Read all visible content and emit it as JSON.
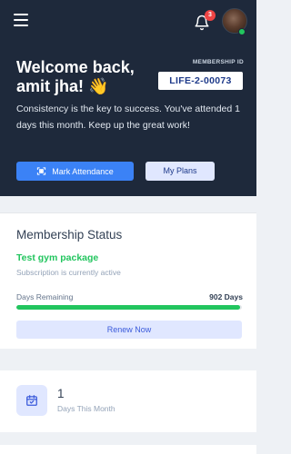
{
  "header": {
    "notification_count": "3",
    "status_color": "#22c55e"
  },
  "hero": {
    "welcome_line1": "Welcome back,",
    "welcome_name": "amit jha!",
    "wave_emoji": "👋",
    "membership_id_label": "MEMBERSHIP ID",
    "membership_id": "LIFE-2-00073",
    "motivation": "Consistency is the key to success. You've attended 1 days this month. Keep up the great work!",
    "mark_attendance_label": "Mark Attendance",
    "my_plans_label": "My Plans"
  },
  "membership": {
    "title": "Membership Status",
    "package_name": "Test gym package",
    "subscription_text": "Subscription is currently active",
    "days_remaining_label": "Days Remaining",
    "days_remaining_value": "902 Days",
    "progress_fraction": 0.99,
    "renew_label": "Renew Now"
  },
  "stats": {
    "days_value": "1",
    "days_label": "Days This Month"
  },
  "icons": {
    "menu": "hamburger-menu-icon",
    "bell": "bell-icon",
    "qr": "qr-scan-icon",
    "calendar": "calendar-check-icon"
  },
  "colors": {
    "hero_bg": "#1e293b",
    "primary": "#3b82f6",
    "success": "#22c55e",
    "badge": "#ef4444"
  }
}
